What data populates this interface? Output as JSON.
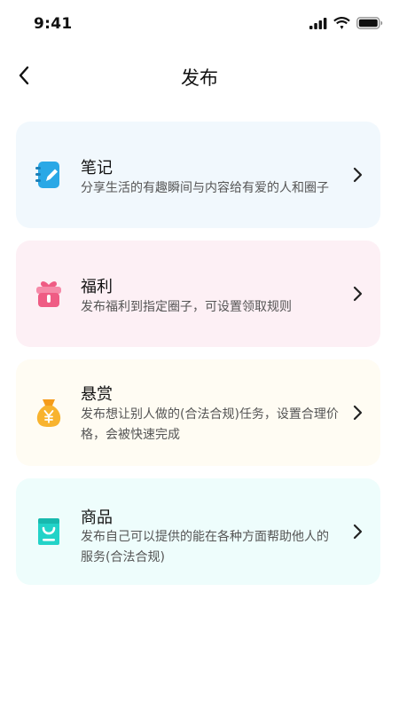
{
  "status_bar": {
    "time": "9:41"
  },
  "header": {
    "title": "发布"
  },
  "cards": [
    {
      "title": "笔记",
      "desc": "分享生活的有趣瞬间与内容给有爱的人和圈子",
      "icon": "notebook-pen-icon",
      "accent": "#2aa8e6",
      "bg": "#f1f8fd"
    },
    {
      "title": "福利",
      "desc": "发布福利到指定圈子，可设置领取规则",
      "icon": "gift-box-icon",
      "accent": "#ef5c84",
      "bg": "#fdf0f5"
    },
    {
      "title": "悬赏",
      "desc": "发布想让别人做的(合法合规)任务，设置合理价格，会被快速完成",
      "icon": "money-bag-icon",
      "accent": "#f8b32e",
      "bg": "#fffcf3"
    },
    {
      "title": "商品",
      "desc": "发布自己可以提供的能在各种方面帮助他人的服务(合法合规)",
      "icon": "shopping-bag-icon",
      "accent": "#22d3c8",
      "bg": "#eefdfc"
    }
  ]
}
